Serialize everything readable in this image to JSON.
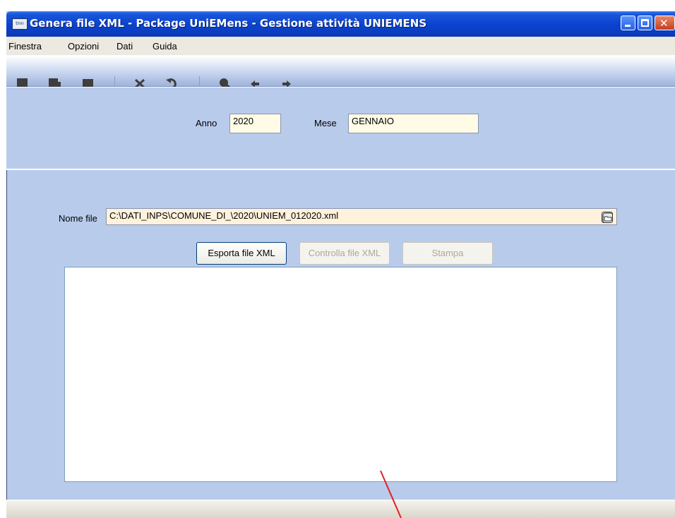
{
  "window": {
    "title": "Genera file XML - Package UniEMens - Gestione attività UNIEMENS",
    "icon_text": "tinn"
  },
  "menu": {
    "items": [
      "Finestra",
      "Opzioni",
      "Dati",
      "Guida"
    ]
  },
  "toolbar": {
    "icons": [
      "new-document-icon",
      "save-document-icon",
      "stop-icon",
      "delete-icon",
      "undo-icon",
      "search-icon",
      "arrow-left-icon",
      "arrow-right-icon"
    ]
  },
  "period": {
    "anno_label": "Anno",
    "anno_value": "2020",
    "mese_label": "Mese",
    "mese_value": "GENNAIO"
  },
  "file": {
    "label": "Nome file",
    "path": "C:\\DATI_INPS\\COMUNE_DI_\\2020\\UNIEM_012020.xml"
  },
  "buttons": {
    "esporta": "Esporta file XML",
    "controlla": "Controlla file XML",
    "stampa": "Stampa"
  },
  "colors": {
    "titlebar": "#0b44cf",
    "panel": "#b9cbeb",
    "annotation": "#e02020"
  }
}
